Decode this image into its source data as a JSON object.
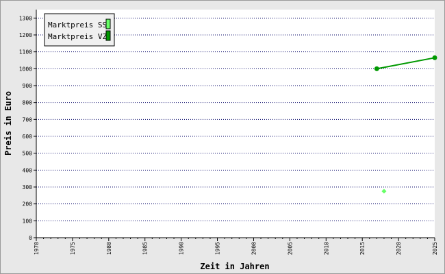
{
  "chart_data": {
    "type": "line",
    "xlabel": "Zeit in Jahren",
    "ylabel": "Preis in Euro",
    "xlim": [
      1970,
      2025
    ],
    "ylim": [
      0,
      1350
    ],
    "x_ticks": [
      "1970",
      "1975",
      "1980",
      "1985",
      "1990",
      "1995",
      "2000",
      "2005",
      "2010",
      "2015",
      "2020",
      "2025"
    ],
    "y_ticks": [
      "0",
      "100",
      "200",
      "300",
      "400",
      "500",
      "600",
      "700",
      "800",
      "900",
      "1000",
      "1100",
      "1200",
      "1300"
    ],
    "grid": "horizontal dotted",
    "legend_position": "top-left",
    "series": [
      {
        "name": "Marktpreis SS",
        "color": "#66ff66",
        "marker": "diamond",
        "line": false,
        "points": [
          {
            "x": 2018,
            "y": 275
          }
        ]
      },
      {
        "name": "Marktpreis VZ",
        "color": "#009900",
        "marker": "circle",
        "line": true,
        "points": [
          {
            "x": 2017,
            "y": 1000
          },
          {
            "x": 2025,
            "y": 1065
          }
        ]
      }
    ]
  }
}
